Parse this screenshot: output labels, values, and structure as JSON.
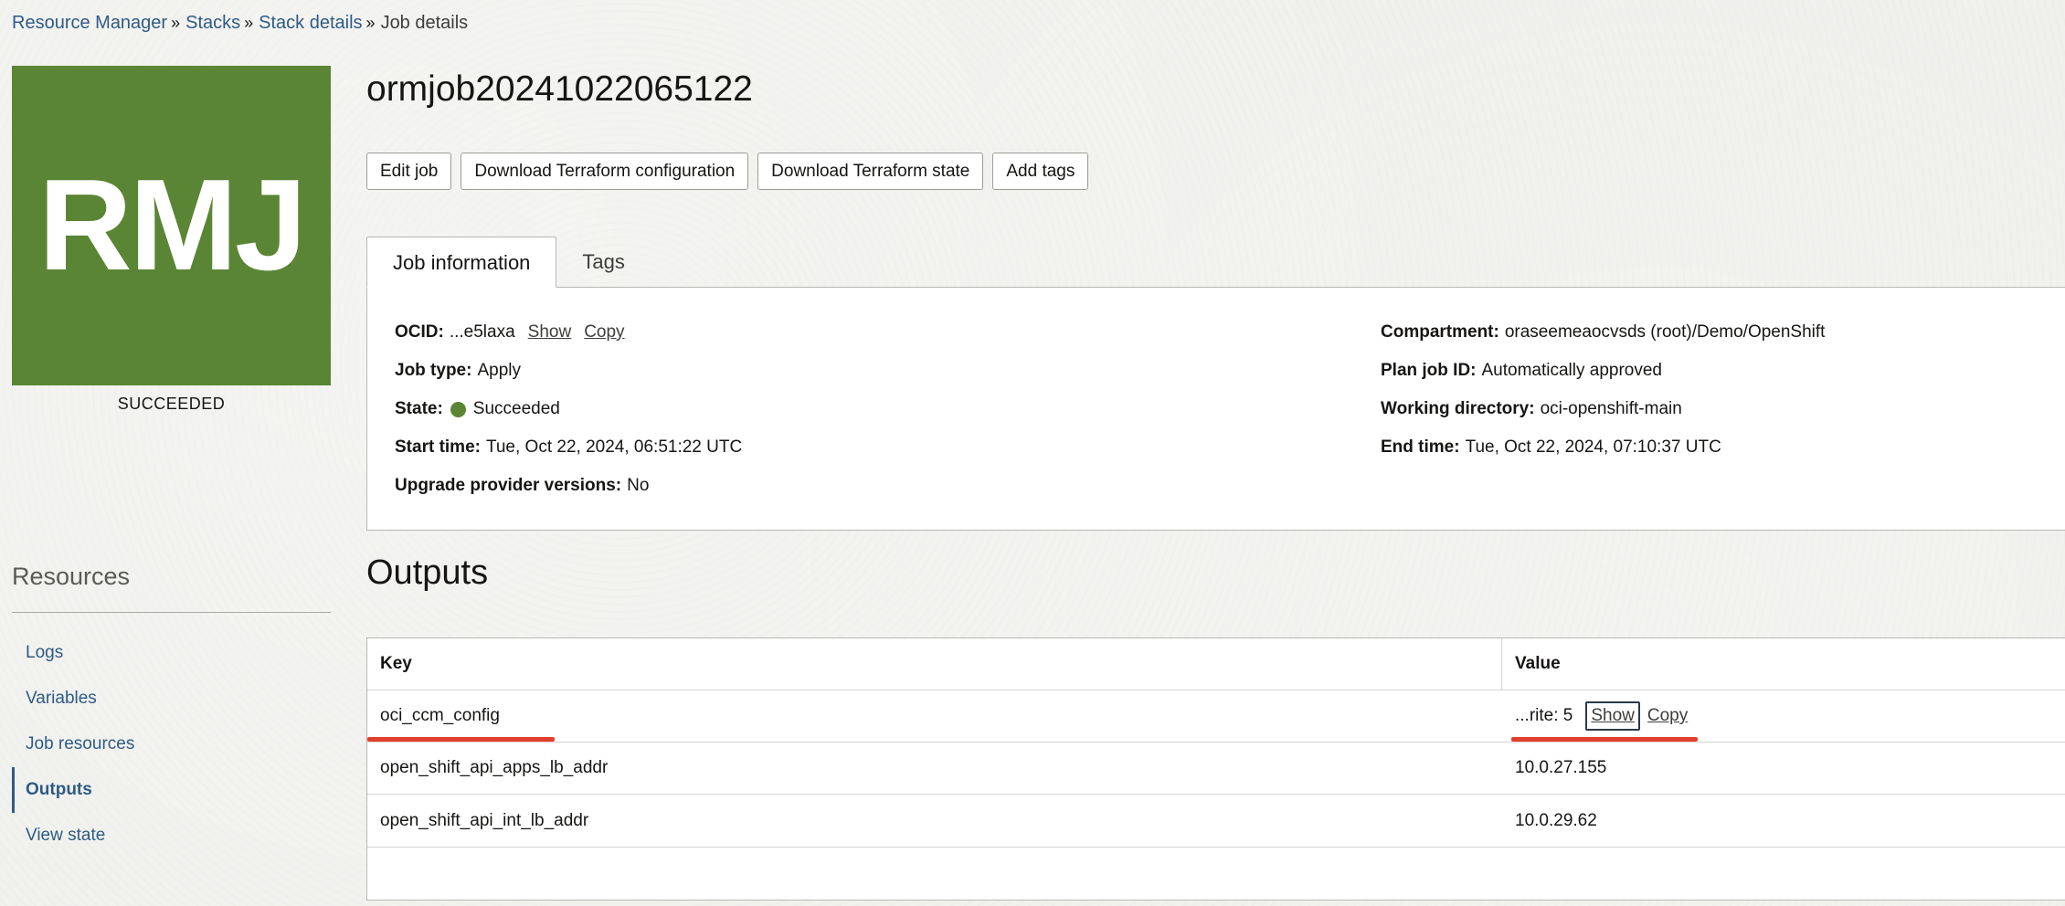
{
  "breadcrumb": {
    "items": [
      "Resource Manager",
      "Stacks",
      "Stack details"
    ],
    "current": "Job details",
    "separator": "»"
  },
  "badge": {
    "initials": "RMJ",
    "status": "SUCCEEDED",
    "color": "#5a8534"
  },
  "page": {
    "title": "ormjob20241022065122"
  },
  "toolbar": {
    "edit_job": "Edit job",
    "download_config": "Download Terraform configuration",
    "download_state": "Download Terraform state",
    "add_tags": "Add tags"
  },
  "tabs": {
    "job_information": "Job information",
    "tags": "Tags"
  },
  "job_info": {
    "ocid_label": "OCID:",
    "ocid_value": "...e5laxa",
    "show": "Show",
    "copy": "Copy",
    "job_type_label": "Job type:",
    "job_type_value": "Apply",
    "state_label": "State:",
    "state_value": "Succeeded",
    "state_color": "#5a8534",
    "start_time_label": "Start time:",
    "start_time_value": "Tue, Oct 22, 2024, 06:51:22 UTC",
    "upgrade_label": "Upgrade provider versions:",
    "upgrade_value": "No",
    "compartment_label": "Compartment:",
    "compartment_value": "oraseemeaocvsds (root)/Demo/OpenShift",
    "plan_job_label": "Plan job ID:",
    "plan_job_value": "Automatically approved",
    "working_dir_label": "Working directory:",
    "working_dir_value": "oci-openshift-main",
    "end_time_label": "End time:",
    "end_time_value": "Tue, Oct 22, 2024, 07:10:37 UTC"
  },
  "resources": {
    "title": "Resources",
    "items": [
      "Logs",
      "Variables",
      "Job resources",
      "Outputs",
      "View state"
    ],
    "active": "Outputs"
  },
  "outputs": {
    "title": "Outputs",
    "columns": [
      "Key",
      "Value"
    ],
    "rows": [
      {
        "key": "oci_ccm_config",
        "value": "...rite: 5",
        "show": "Show",
        "copy": "Copy"
      },
      {
        "key": "open_shift_api_apps_lb_addr",
        "value": "10.0.27.155"
      },
      {
        "key": "open_shift_api_int_lb_addr",
        "value": "10.0.29.62"
      }
    ],
    "highlight_color": "#e23d2d"
  }
}
